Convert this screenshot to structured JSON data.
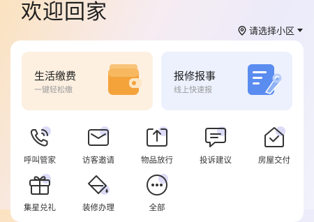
{
  "header": {
    "welcome": "欢迎回家",
    "location_label": "请选择小区"
  },
  "cards": [
    {
      "title": "生活缴费",
      "subtitle": "一键轻松缴",
      "icon": "wallet-icon"
    },
    {
      "title": "报修报事",
      "subtitle": "线上快速报",
      "icon": "repair-form-icon"
    }
  ],
  "services": [
    {
      "label": "呼叫管家",
      "icon": "phone-icon"
    },
    {
      "label": "访客邀请",
      "icon": "envelope-icon"
    },
    {
      "label": "物品放行",
      "icon": "box-upload-icon"
    },
    {
      "label": "投诉建议",
      "icon": "chat-bubble-icon"
    },
    {
      "label": "房屋交付",
      "icon": "house-check-icon"
    },
    {
      "label": "集星兑礼",
      "icon": "gift-icon"
    },
    {
      "label": "装修办理",
      "icon": "paint-bucket-icon"
    },
    {
      "label": "全部",
      "icon": "more-dots-icon"
    }
  ],
  "colors": {
    "accent_orange": "#f5a43a",
    "accent_blue": "#5b8cf0",
    "icon_stroke": "#333333"
  }
}
